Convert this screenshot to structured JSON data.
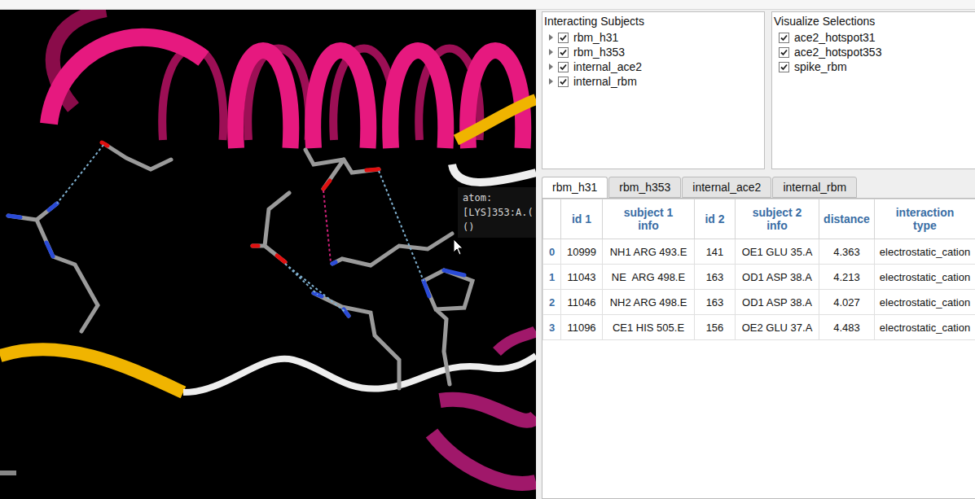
{
  "viewer": {
    "tooltip": [
      "atom:",
      "[LYS]353:A.(",
      "()"
    ]
  },
  "subjects_panel": {
    "title": "Interacting Subjects",
    "items": [
      {
        "label": "rbm_h31",
        "checked": true,
        "expanded": false
      },
      {
        "label": "rbm_h353",
        "checked": true,
        "expanded": false
      },
      {
        "label": "internal_ace2",
        "checked": true,
        "expanded": false
      },
      {
        "label": "internal_rbm",
        "checked": true,
        "expanded": false
      }
    ]
  },
  "selections_panel": {
    "title": "Visualize Selections",
    "items": [
      {
        "label": "ace2_hotspot31",
        "checked": true
      },
      {
        "label": "ace2_hotspot353",
        "checked": true
      },
      {
        "label": "spike_rbm",
        "checked": true
      }
    ]
  },
  "tabs": [
    {
      "label": "rbm_h31",
      "selected": true
    },
    {
      "label": "rbm_h353",
      "selected": false
    },
    {
      "label": "internal_ace2",
      "selected": false
    },
    {
      "label": "internal_rbm",
      "selected": false
    }
  ],
  "table": {
    "columns": [
      "",
      "id 1",
      "subject 1 info",
      "id 2",
      "subject 2 info",
      "distance",
      "interaction type"
    ],
    "rows": [
      {
        "index": "0",
        "id1": "10999",
        "subject1": "NH1 ARG 493.E",
        "id2": "141",
        "subject2": "OE1 GLU 35.A",
        "distance": "4.363",
        "type": "electrostatic_cation"
      },
      {
        "index": "1",
        "id1": "11043",
        "subject1": "NE  ARG 498.E",
        "id2": "163",
        "subject2": "OD1 ASP 38.A",
        "distance": "4.213",
        "type": "electrostatic_cation"
      },
      {
        "index": "2",
        "id1": "11046",
        "subject1": "NH2 ARG 498.E",
        "id2": "163",
        "subject2": "OD1 ASP 38.A",
        "distance": "4.027",
        "type": "electrostatic_cation"
      },
      {
        "index": "3",
        "id1": "11096",
        "subject1": "CE1 HIS 505.E",
        "id2": "156",
        "subject2": "OE2 GLU 37.A",
        "distance": "4.483",
        "type": "electrostatic_cation"
      }
    ]
  }
}
